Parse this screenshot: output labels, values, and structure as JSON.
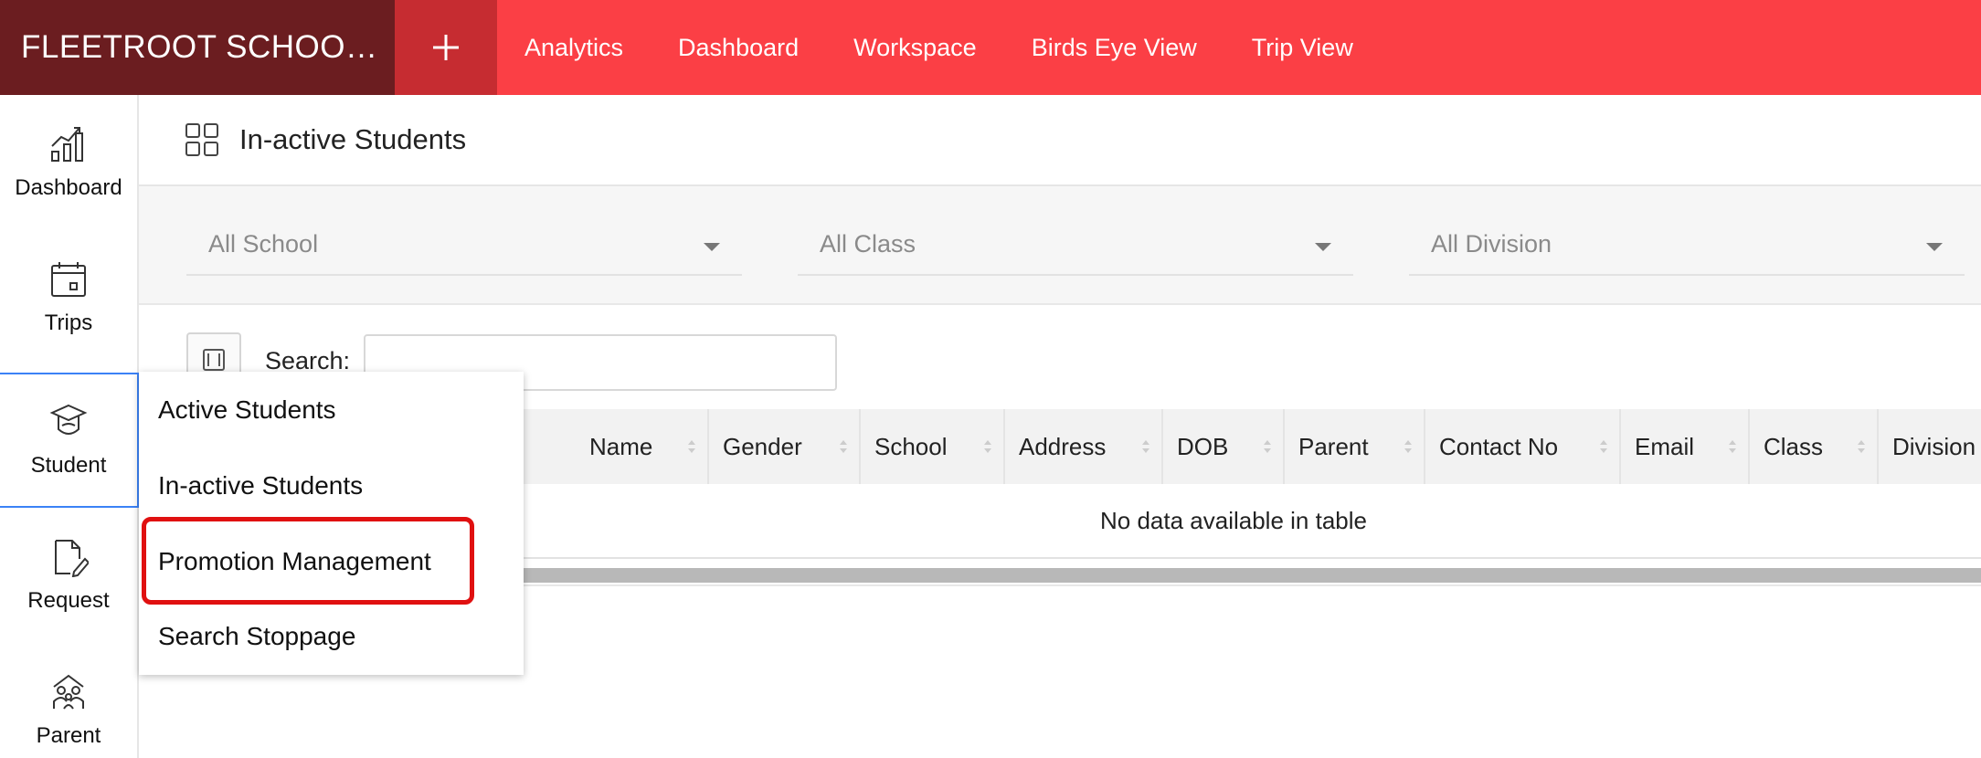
{
  "topbar": {
    "brand": "FLEETROOT SCHOO…",
    "add_button": "+",
    "nav": [
      "Analytics",
      "Dashboard",
      "Workspace",
      "Birds Eye View",
      "Trip View"
    ]
  },
  "sidebar": {
    "items": [
      {
        "label": "Dashboard",
        "icon": "bar-chart-icon"
      },
      {
        "label": "Trips",
        "icon": "calendar-icon"
      },
      {
        "label": "Student",
        "icon": "graduation-cap-icon",
        "active": true
      },
      {
        "label": "Request",
        "icon": "edit-document-icon"
      },
      {
        "label": "Parent",
        "icon": "family-icon"
      }
    ]
  },
  "page": {
    "title": "In-active Students"
  },
  "filters": {
    "school": "All School",
    "class": "All Class",
    "division": "All Division"
  },
  "search": {
    "label": "Search:",
    "value": ""
  },
  "table": {
    "columns": [
      "Name",
      "Gender",
      "School",
      "Address",
      "DOB",
      "Parent",
      "Contact No",
      "Email",
      "Class",
      "Division"
    ],
    "empty_message": "No data available in table"
  },
  "student_menu": {
    "items": [
      "Active Students",
      "In-active Students",
      "Promotion Management",
      "Search Stoppage"
    ],
    "highlighted": "Promotion Management"
  },
  "colors": {
    "topbar": "#fb3f45",
    "brand_bg": "#6b1d20",
    "add_button_bg": "#c62c31",
    "active_border": "#3b82f6",
    "highlight": "#e01010"
  }
}
